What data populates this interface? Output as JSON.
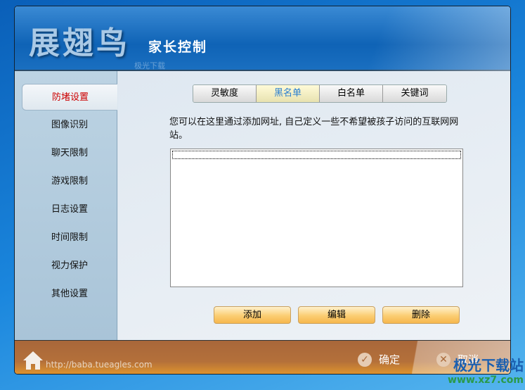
{
  "header": {
    "logo": "展翅鸟",
    "subtitle": "家长控制",
    "faint_mark": "极光下载"
  },
  "sidebar": {
    "items": [
      {
        "label": "防堵设置",
        "active": true
      },
      {
        "label": "图像识别"
      },
      {
        "label": "聊天限制"
      },
      {
        "label": "游戏限制"
      },
      {
        "label": "日志设置"
      },
      {
        "label": "时间限制"
      },
      {
        "label": "视力保护"
      },
      {
        "label": "其他设置"
      }
    ]
  },
  "tabs": [
    {
      "label": "灵敏度"
    },
    {
      "label": "黑名单",
      "active": true
    },
    {
      "label": "白名单"
    },
    {
      "label": "关键词"
    }
  ],
  "description": "您可以在这里通过添加网址, 自己定义一些不希望被孩子访问的互联网网站。",
  "buttons": {
    "add": "添加",
    "edit": "编辑",
    "delete": "删除"
  },
  "footer": {
    "url": "http://baba.tueagles.com",
    "ok": "确定",
    "cancel": "取消"
  },
  "watermark": {
    "name": "极光下载站",
    "site": "www.xz7.com"
  }
}
